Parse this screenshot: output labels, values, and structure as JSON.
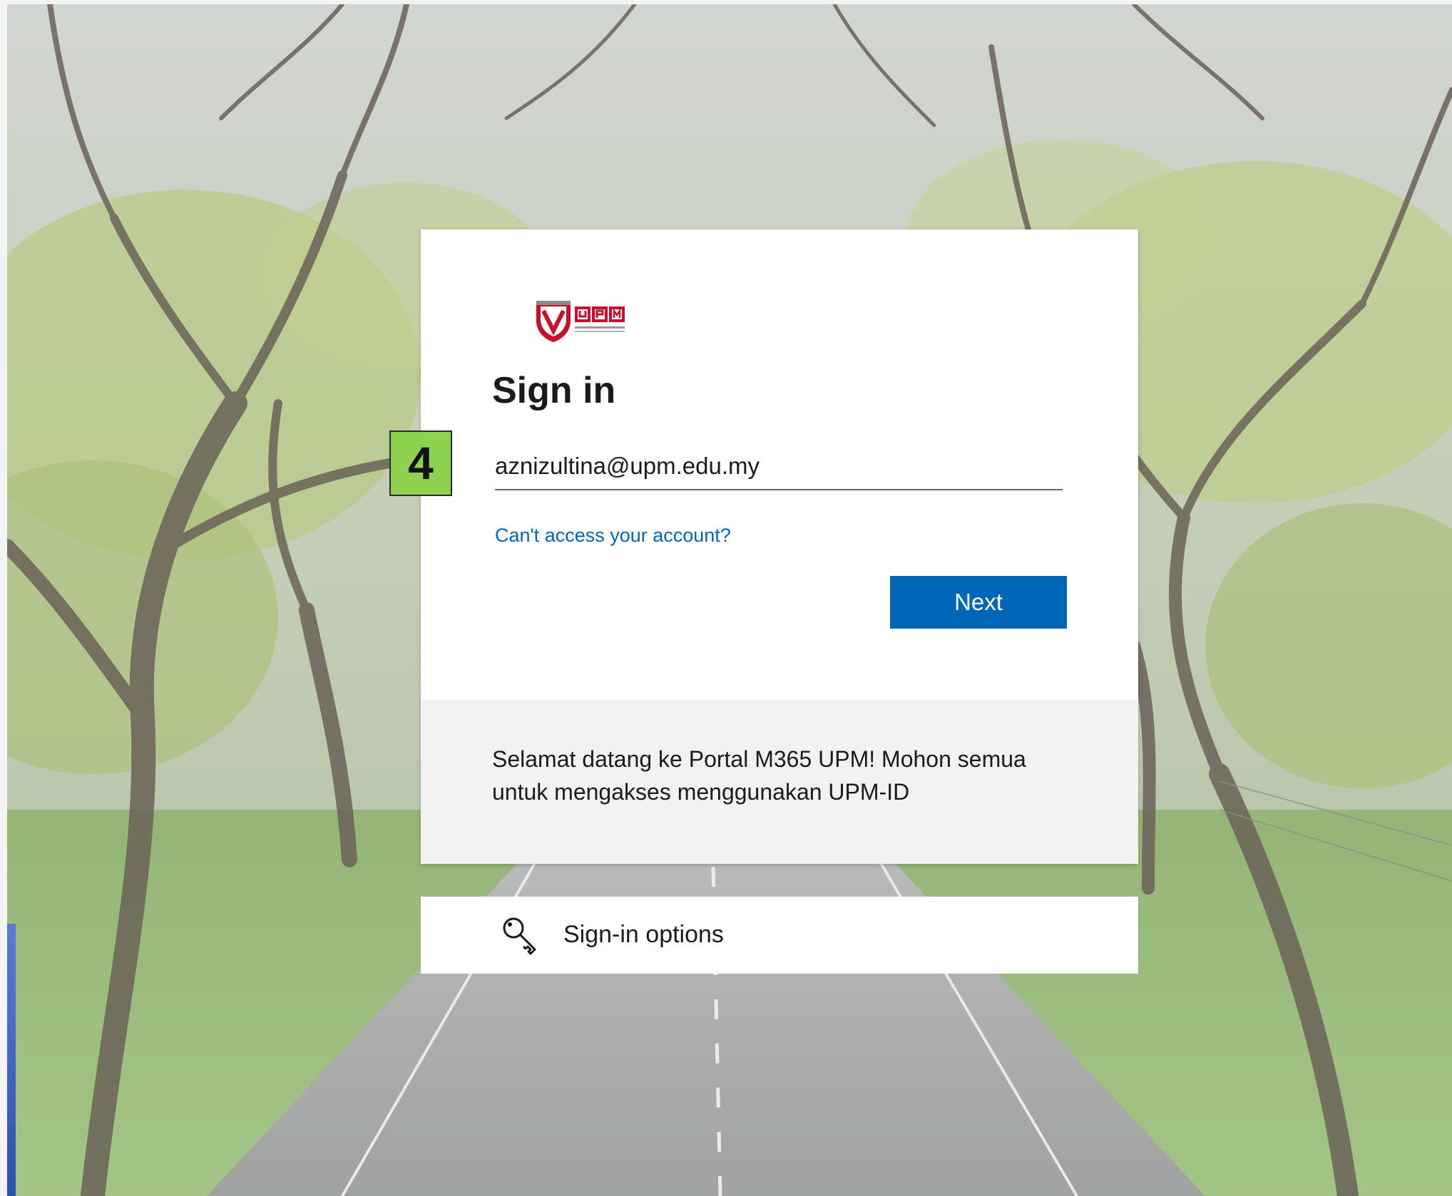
{
  "signin": {
    "title": "Sign in",
    "email_value": "aznizultina@upm.edu.my",
    "cant_access_link": "Can't access your account?",
    "next_button": "Next"
  },
  "banner": {
    "message": "Selamat datang ke Portal M365 UPM! Mohon semua untuk mengakses menggunakan UPM-ID"
  },
  "options": {
    "label": "Sign-in options",
    "icon": "key-icon"
  },
  "step_marker": {
    "label": "4"
  },
  "logo": {
    "text": "UPM",
    "icon": "upm-crest-logo"
  },
  "colors": {
    "accent": "#0067b8",
    "step_marker": "#8ed14f",
    "banner_bg": "#f2f2f2"
  }
}
